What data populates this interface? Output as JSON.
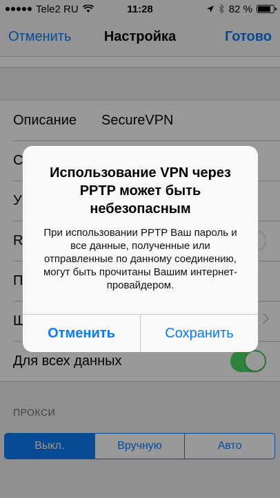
{
  "status_bar": {
    "carrier": "Tele2 RU",
    "time": "11:28",
    "battery_percent": "82 %",
    "battery_level": 0.82
  },
  "nav": {
    "cancel_label": "Отменить",
    "title": "Настройка",
    "done_label": "Готово"
  },
  "settings": {
    "description_label": "Описание",
    "description_value": "SecureVPN",
    "row2_label": "С",
    "row3_label": "У",
    "row4_label": "R",
    "row5_label": "П",
    "row6_label": "Ш",
    "send_all_label": "Для всех данных",
    "send_all_on": true
  },
  "proxy": {
    "header": "ПРОКСИ",
    "options": [
      "Выкл.",
      "Вручную",
      "Авто"
    ],
    "selected": "Выкл."
  },
  "alert": {
    "title": "Использование VPN через PPTP может быть небезопасным",
    "message": "При использовании PPTP Ваш пароль и все данные, полученные или отправленные по данному соединению, могут быть прочитаны Вашим интернет-провайдером.",
    "cancel_label": "Отменить",
    "save_label": "Сохранить"
  },
  "colors": {
    "accent": "#0a7cf7",
    "toggle_on": "#4cd964"
  }
}
